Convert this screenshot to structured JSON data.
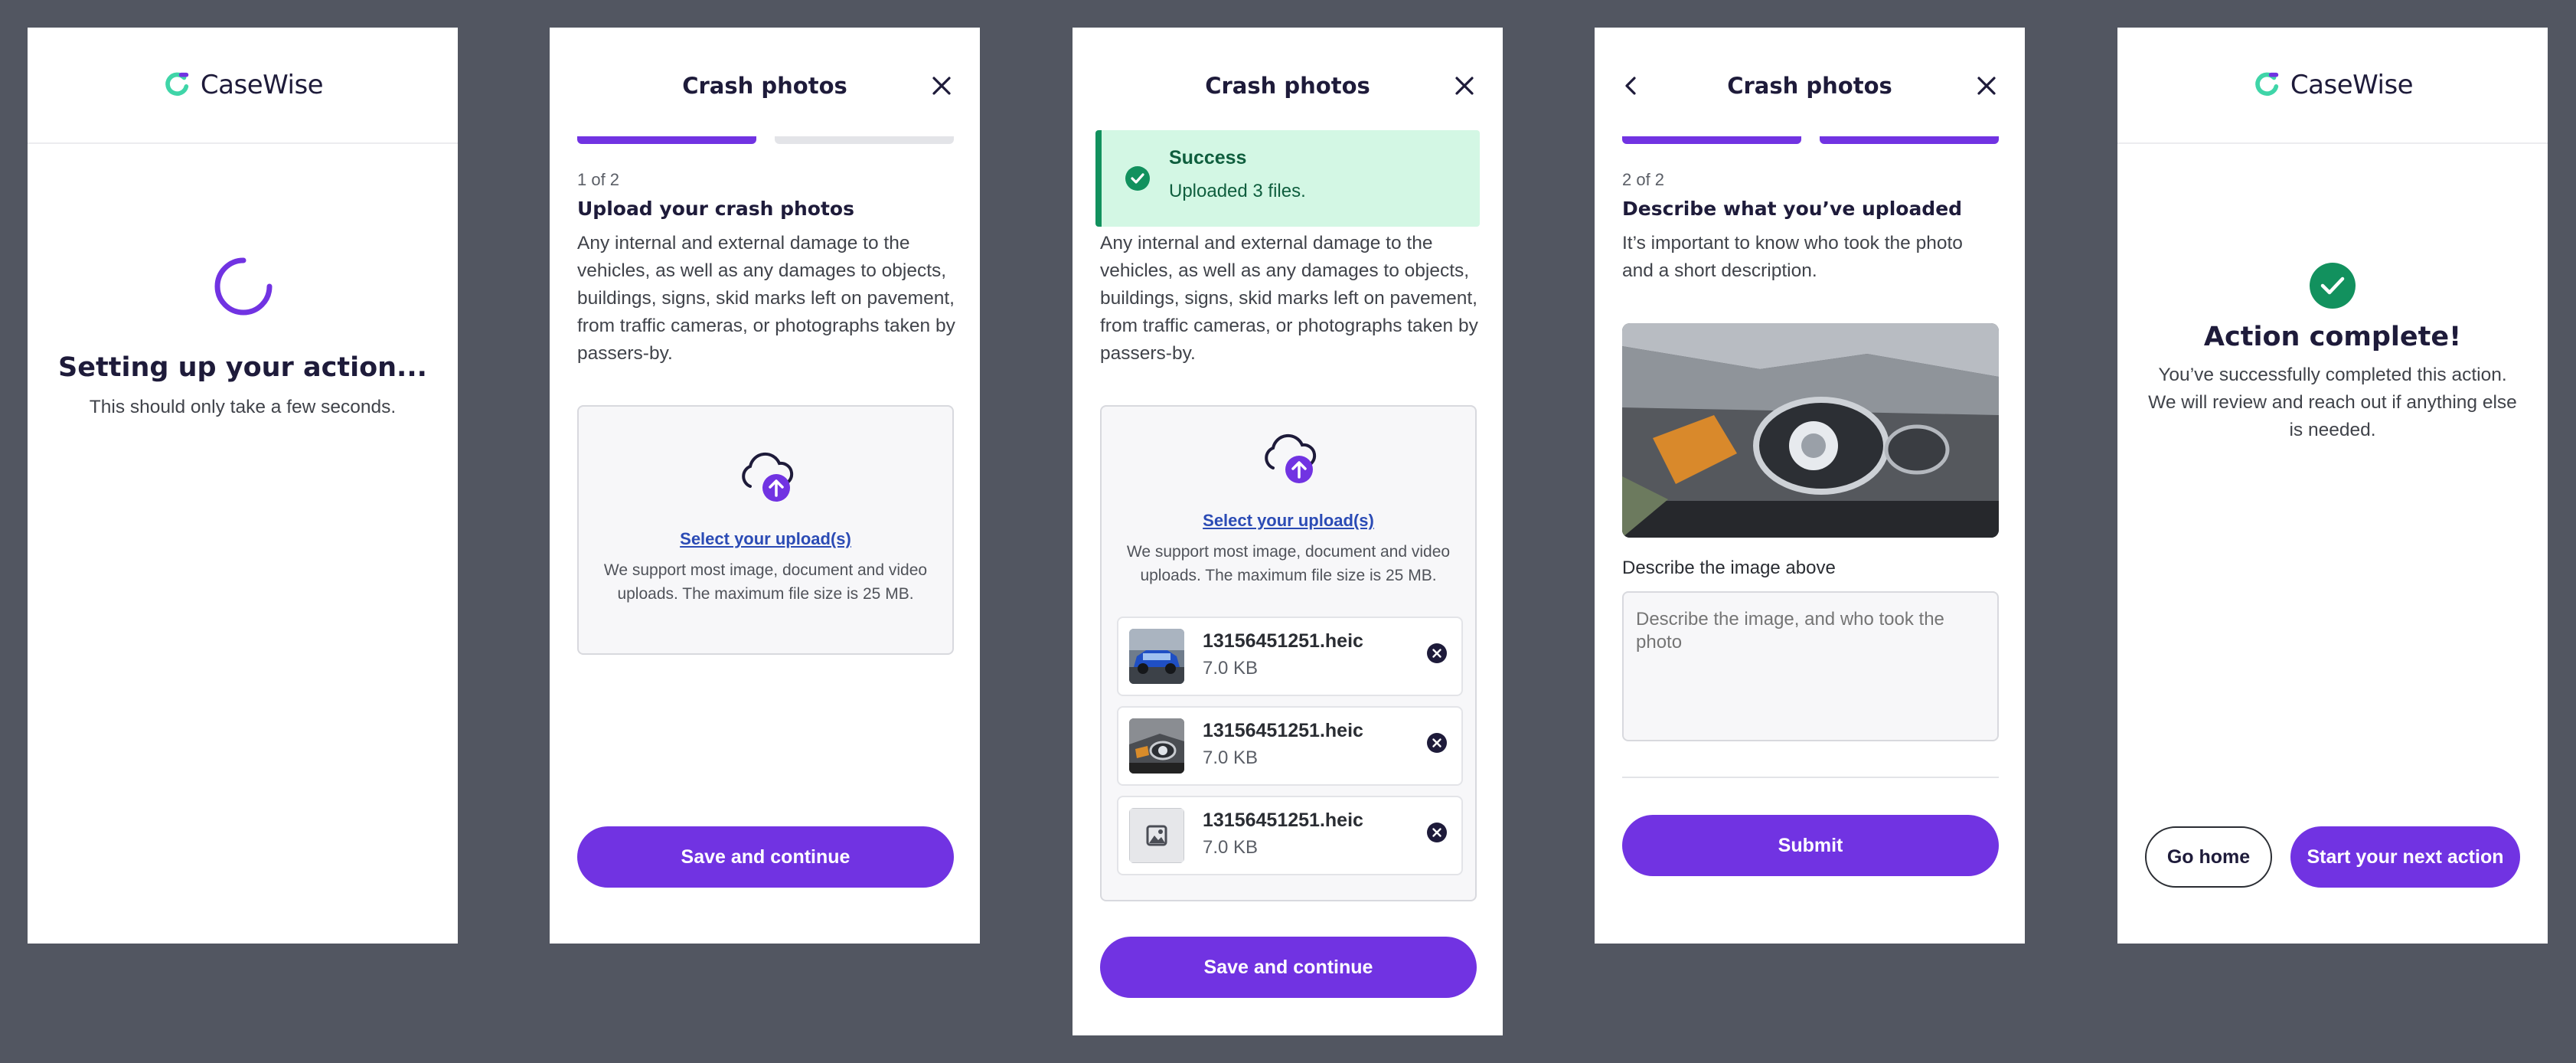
{
  "brand": {
    "name": "CaseWise"
  },
  "colors": {
    "primary": "#7133e2",
    "success": "#12915e",
    "success_bg": "#d3f7e4",
    "link": "#2b4bb5",
    "backdrop": "#525661"
  },
  "loading": {
    "title": "Setting up your action...",
    "subtitle": "This should only take a few seconds."
  },
  "upload": {
    "header_title": "Crash photos",
    "step": "1 of 2",
    "heading": "Upload your crash photos",
    "description": "Any internal and external damage to the vehicles, as well as any damages to objects, buildings, signs, skid marks left on pavement, from traffic cameras, or photographs taken by passers-by.",
    "select_link": "Select your upload(s)",
    "help": "We support most image, document and video uploads. The maximum file size is 25 MB.",
    "save_button": "Save and continue"
  },
  "uploaded": {
    "header_title": "Crash photos",
    "banner_title": "Success",
    "banner_message": "Uploaded 3 files.",
    "description": "Any internal and external damage to the vehicles, as well as any damages to objects, buildings, signs, skid marks left on pavement, from traffic cameras, or photographs taken by passers-by.",
    "select_link": "Select your upload(s)",
    "help": "We support most image, document and video uploads. The maximum file size is 25 MB.",
    "files": [
      {
        "name": "13156451251.heic",
        "size": "7.0 KB",
        "thumb": "blue-car-photo"
      },
      {
        "name": "13156451251.heic",
        "size": "7.0 KB",
        "thumb": "crash-photo"
      },
      {
        "name": "13156451251.heic",
        "size": "7.0 KB",
        "thumb": "image-placeholder-icon"
      }
    ],
    "save_button": "Save and continue"
  },
  "describe": {
    "header_title": "Crash photos",
    "step": "2 of 2",
    "heading": "Describe what you’ve uploaded",
    "description": "It’s important to know who took the photo and a short description.",
    "field_label": "Describe the image above",
    "field_placeholder": "Describe the image, and who took the photo",
    "submit_button": "Submit"
  },
  "complete": {
    "title": "Action complete!",
    "message": "You’ve successfully completed this action. We will review and reach out if anything else is needed.",
    "home_button": "Go home",
    "next_button": "Start your next action"
  }
}
